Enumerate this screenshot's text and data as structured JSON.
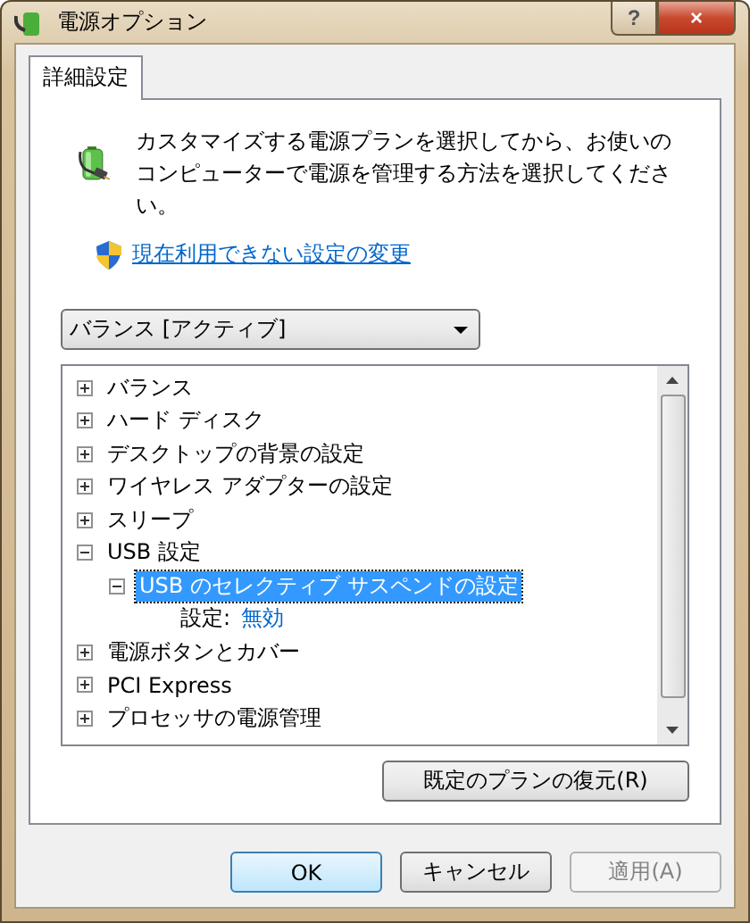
{
  "window": {
    "title": "電源オプション",
    "buttons": [
      "?",
      "×"
    ]
  },
  "tabs": [
    {
      "label": "詳細設定",
      "selected": true
    }
  ],
  "description": "カスタマイズする電源プランを選択してから、お使いのコンピューターで電源を管理する方法を選択してください。",
  "admin_link": "現在利用できない設定の変更",
  "plan_dropdown": {
    "value": "バランス [アクティブ]"
  },
  "tree": [
    {
      "label": "バランス",
      "expanded": false,
      "selected": false
    },
    {
      "label": "ハード ディスク",
      "expanded": false,
      "selected": false
    },
    {
      "label": "デスクトップの背景の設定",
      "expanded": false,
      "selected": false
    },
    {
      "label": "ワイヤレス アダプターの設定",
      "expanded": false,
      "selected": false
    },
    {
      "label": "スリープ",
      "expanded": false,
      "selected": false
    },
    {
      "label": "USB 設定",
      "expanded": true,
      "selected": false,
      "children": [
        {
          "label": "USB のセレクティブ サスペンドの設定",
          "expanded": true,
          "selected": true,
          "children": [
            {
              "kind": "setting",
              "label": "設定:",
              "value": "無効"
            }
          ]
        }
      ]
    },
    {
      "label": "電源ボタンとカバー",
      "expanded": false,
      "selected": false
    },
    {
      "label": "PCI Express",
      "expanded": false,
      "selected": false
    },
    {
      "label": "プロセッサの電源管理",
      "expanded": false,
      "selected": false
    }
  ],
  "restore_button": {
    "label": "既定のプランの復元(R)"
  },
  "buttons": [
    {
      "label": "OK",
      "disabled": false,
      "default": true
    },
    {
      "label": "キャンセル",
      "disabled": false,
      "default": false
    },
    {
      "label": "適用(A)",
      "disabled": true,
      "default": false
    }
  ]
}
